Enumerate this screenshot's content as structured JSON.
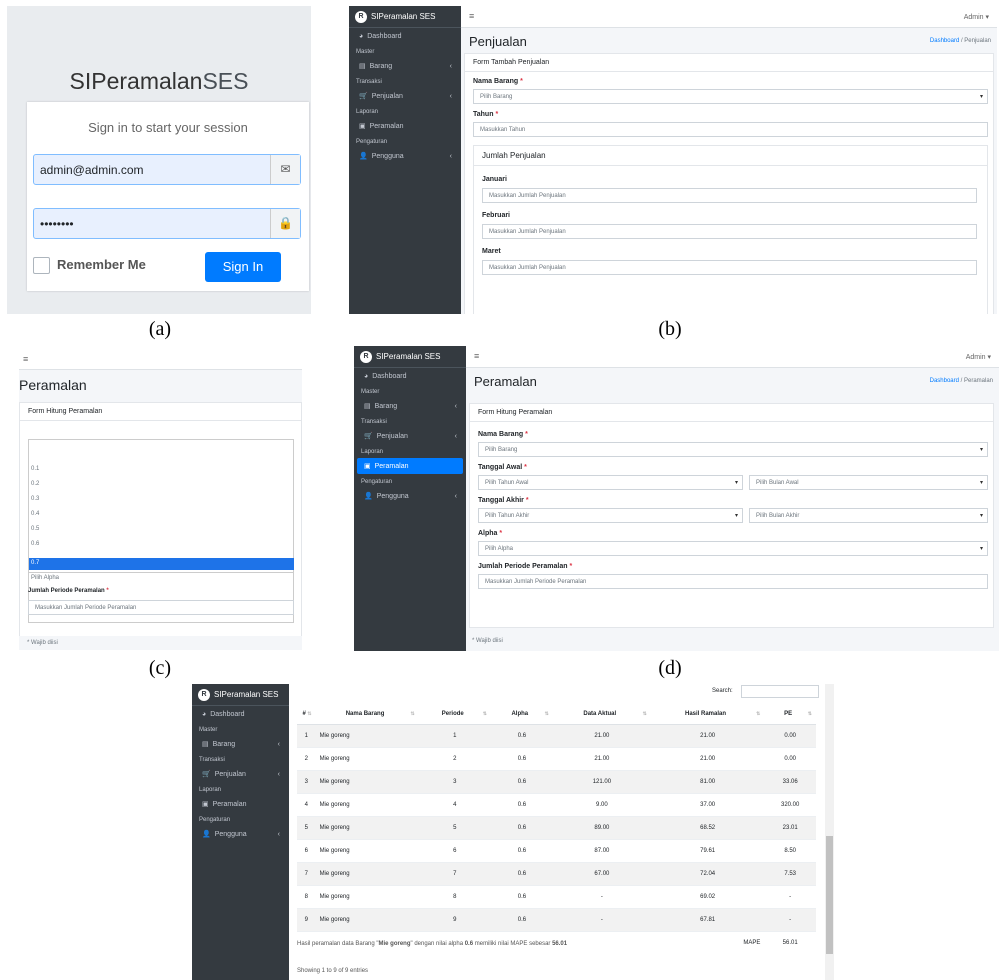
{
  "captions": [
    "(a)",
    "(b)",
    "(c)",
    "(d)"
  ],
  "login": {
    "logo_a": "SIPeramalan",
    "logo_b": "SES",
    "message": "Sign in to start your session",
    "email": "admin@admin.com",
    "password": "••••••••",
    "remember": "Remember Me",
    "signin": "Sign In",
    "icons": [
      "envelope-icon",
      "lock-icon"
    ]
  },
  "sidebar": {
    "brand": "SIPeramalan SES",
    "dashboard": "Dashboard",
    "h_master": "Master",
    "barang": "Barang",
    "h_transaksi": "Transaksi",
    "penjualan": "Penjualan",
    "h_laporan": "Laporan",
    "peramalan": "Peramalan",
    "h_pengaturan": "Pengaturan",
    "pengguna": "Pengguna"
  },
  "topbar": {
    "menu": "≡",
    "admin": "Admin ▾"
  },
  "penjualan": {
    "title": "Penjualan",
    "bc_home": "Dashboard",
    "bc_sep": "/",
    "bc_cur": "Penjualan",
    "card": "Form Tambah Penjualan",
    "l_nama": "Nama Barang",
    "ph_nama": "Pilih Barang",
    "l_tahun": "Tahun",
    "ph_tahun": "Masukkan Tahun",
    "sub": "Jumlah Penjualan",
    "months": [
      "Januari",
      "Februari",
      "Maret"
    ],
    "ph_jumlah": "Masukkan Jumlah Penjualan",
    "req": "*"
  },
  "alpha_dd": {
    "title": "Peramalan",
    "card": "Form Hitung Peramalan",
    "options": [
      "0.1",
      "0.2",
      "0.3",
      "0.4",
      "0.5",
      "0.6",
      "0.7"
    ],
    "selected": "Pilih Alpha",
    "l_periode": "Jumlah Periode Peramalan",
    "ph_periode": "Masukkan Jumlah Periode Peramalan",
    "wajib": "* Wajib diisi"
  },
  "peramalan": {
    "title": "Peramalan",
    "bc_home": "Dashboard",
    "bc_sep": "/",
    "bc_cur": "Peramalan",
    "card": "Form Hitung Peramalan",
    "l_nama": "Nama Barang",
    "ph_nama": "Pilih Barang",
    "l_awal": "Tanggal Awal",
    "ph_tahun_awal": "Pilih Tahun Awal",
    "ph_bulan_awal": "Pilih Bulan Awal",
    "l_akhir": "Tanggal Akhir",
    "ph_tahun_akhir": "Pilih Tahun Akhir",
    "ph_bulan_akhir": "Pilih Bulan Akhir",
    "l_alpha": "Alpha",
    "ph_alpha": "Pilih Alpha",
    "l_periode": "Jumlah Periode Peramalan",
    "ph_periode": "Masukkan Jumlah Periode Peramalan",
    "wajib": "* Wajib diisi"
  },
  "hasil": {
    "search": "Search:",
    "headers": [
      "#",
      "Nama Barang",
      "Periode",
      "Alpha",
      "Data Aktual",
      "Hasil Ramalan",
      "PE"
    ],
    "rows": [
      [
        "1",
        "Mie goreng",
        "1",
        "0.6",
        "21.00",
        "21.00",
        "0.00"
      ],
      [
        "2",
        "Mie goreng",
        "2",
        "0.6",
        "21.00",
        "21.00",
        "0.00"
      ],
      [
        "3",
        "Mie goreng",
        "3",
        "0.6",
        "121.00",
        "81.00",
        "33.06"
      ],
      [
        "4",
        "Mie goreng",
        "4",
        "0.6",
        "9.00",
        "37.00",
        "320.00"
      ],
      [
        "5",
        "Mie goreng",
        "5",
        "0.6",
        "89.00",
        "68.52",
        "23.01"
      ],
      [
        "6",
        "Mie goreng",
        "6",
        "0.6",
        "87.00",
        "79.61",
        "8.50"
      ],
      [
        "7",
        "Mie goreng",
        "7",
        "0.6",
        "67.00",
        "72.04",
        "7.53"
      ],
      [
        "8",
        "Mie goreng",
        "8",
        "0.6",
        "-",
        "69.02",
        "-"
      ],
      [
        "9",
        "Mie goreng",
        "9",
        "0.6",
        "-",
        "67.81",
        "-"
      ]
    ],
    "mape_label": "MAPE",
    "mape_value": "56.01",
    "sum_a": "Hasil peramalan data Barang \"",
    "sum_b": "Mie goreng",
    "sum_c": "\" dengan nilai alpha ",
    "sum_d": "0.6",
    "sum_e": " memiliki nilai MAPE sebesar ",
    "sum_f": "56.01",
    "showing": "Showing 1 to 9 of 9 entries"
  }
}
